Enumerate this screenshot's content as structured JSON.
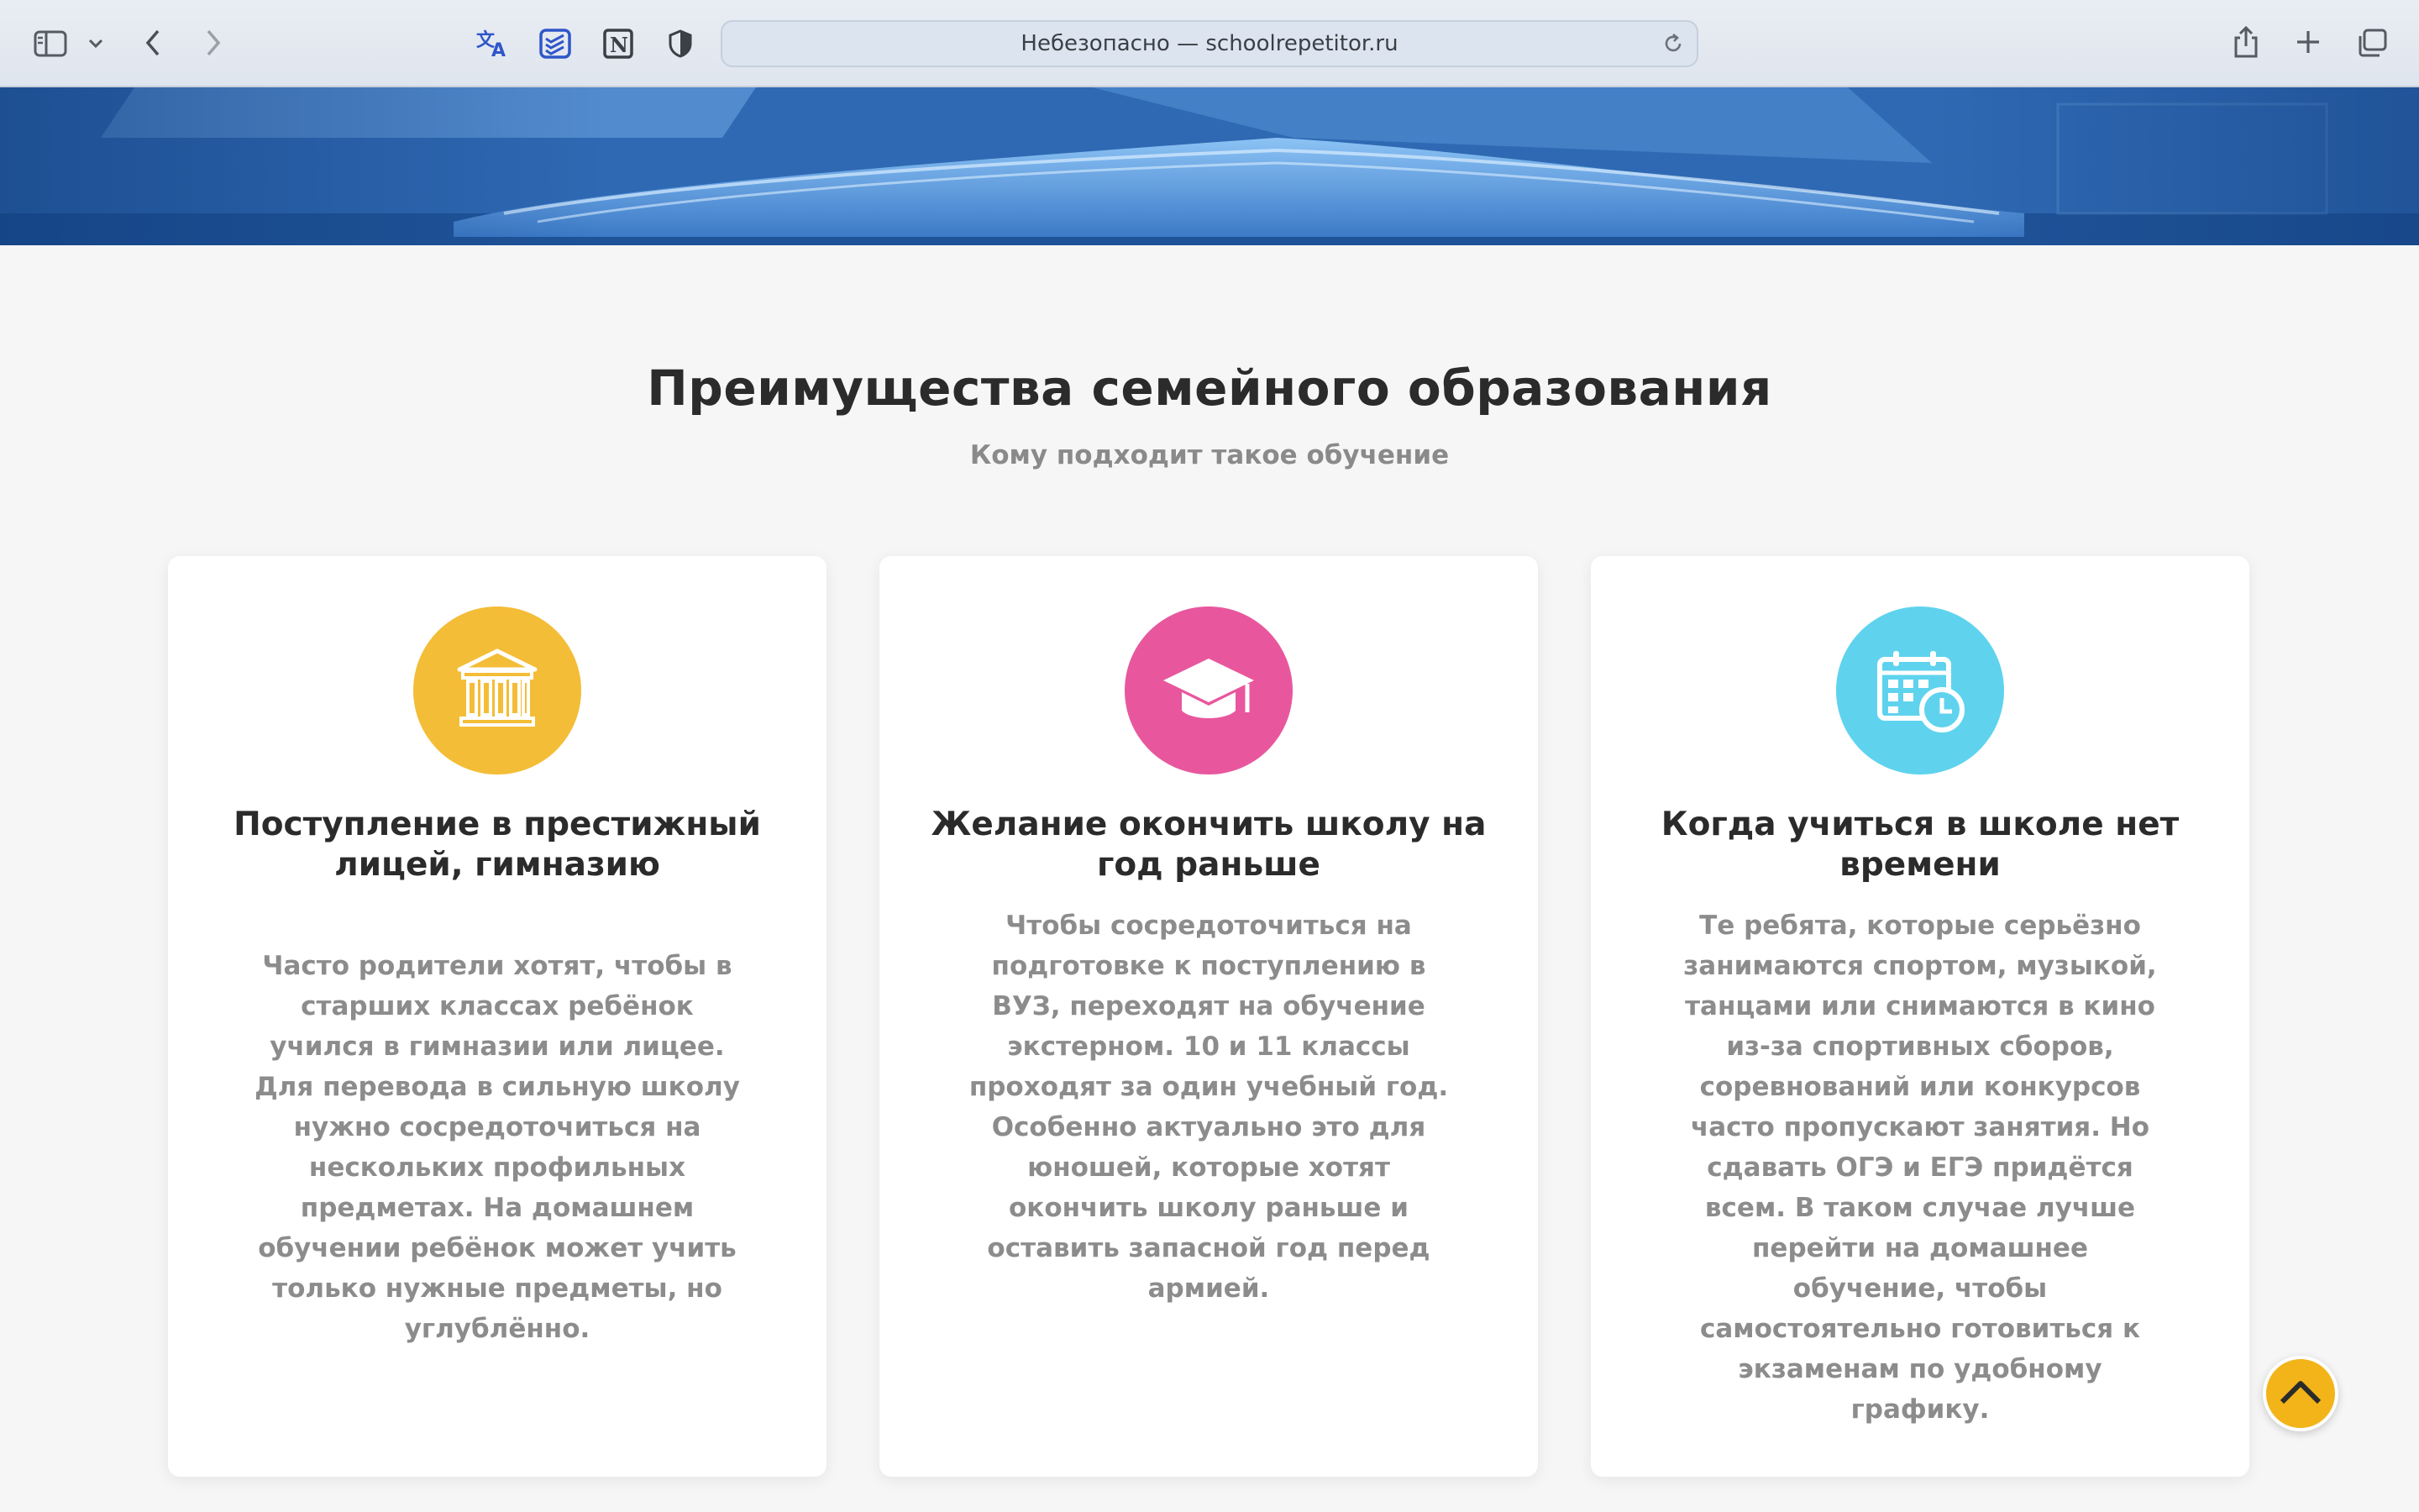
{
  "browser": {
    "url_text": "Небезопасно — schoolrepetitor.ru",
    "toolbar_icons": [
      "sidebar-icon",
      "chevron-down-icon",
      "back-icon",
      "forward-icon",
      "translate-icon",
      "todoist-icon",
      "notion-icon",
      "privacy-shield-icon",
      "reload-icon",
      "share-icon",
      "plus-icon",
      "tabs-icon"
    ]
  },
  "section": {
    "title": "Преимущества семейного образования",
    "subtitle": "Кому подходит такое обучение"
  },
  "cards": [
    {
      "icon": "institution-icon",
      "icon_color": "#f4bd37",
      "title": "Поступление в престижный лицей, гимназию",
      "text": "Часто родители хотят, чтобы в старших классах ребёнок учился в гимназии или лицее. Для перевода в сильную школу нужно сосредоточиться на нескольких профильных предметах. На домашнем обучении ребёнок может учить только нужные предметы, но углублённо."
    },
    {
      "icon": "graduation-cap-icon",
      "icon_color": "#e8579d",
      "title": "Желание окончить школу на год раньше",
      "text": "Чтобы сосредоточиться на подготовке к поступлению в ВУЗ, переходят на обучение экстерном. 10 и 11 классы проходят за один учебный год. Особенно актуально это для юношей, которые хотят окончить школу раньше и оставить запасной год перед армией."
    },
    {
      "icon": "calendar-clock-icon",
      "icon_color": "#5fd3ee",
      "title": "Когда учиться в школе нет времени",
      "text": "Те ребята, которые серьёзно занимаются спортом, музыкой, танцами или снимаются в кино из-за спортивных сборов, соревнований или конкурсов часто пропускают занятия. Но сдавать ОГЭ и ЕГЭ придётся всем. В таком случае лучше перейти на домашнее обучение, чтобы самостоятельно готовиться к экзаменам по удобному графику."
    }
  ],
  "scroll_top": {
    "icon": "chevron-up-icon",
    "color": "#f2b419"
  }
}
